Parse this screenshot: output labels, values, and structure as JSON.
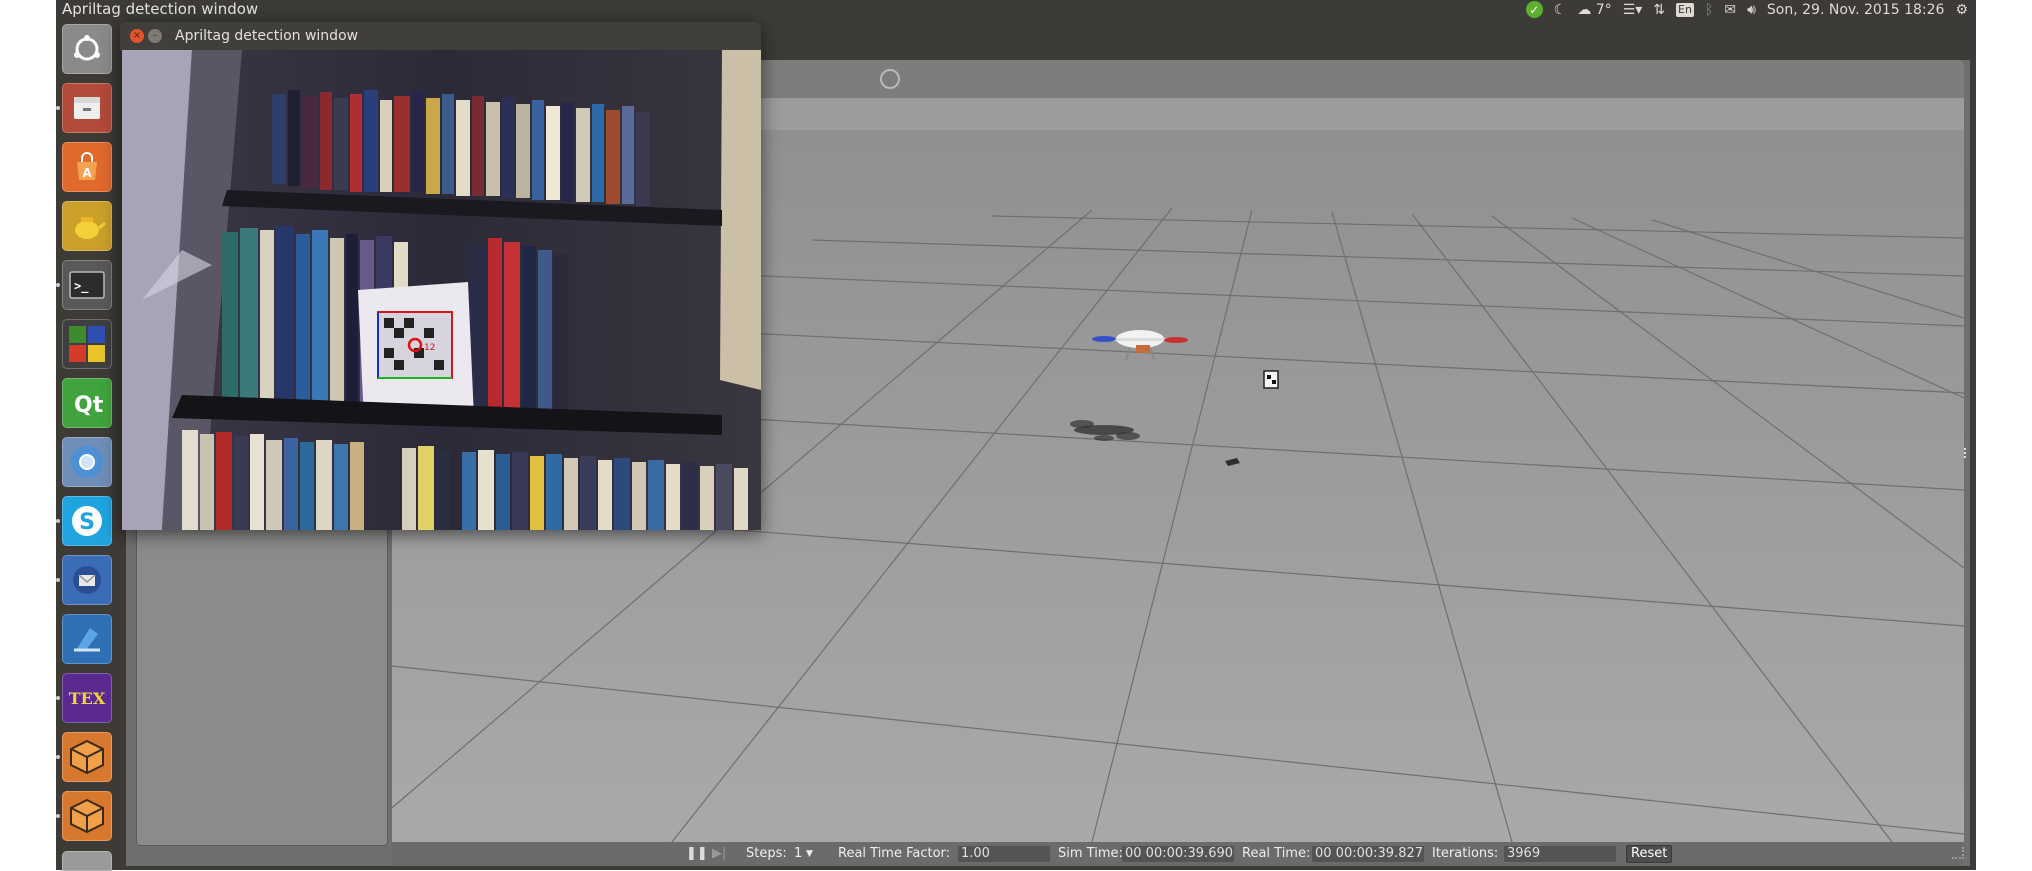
{
  "top_panel": {
    "app_title": "Apriltag detection window",
    "weather": "7°",
    "keyboard_layout": "En",
    "clock": "Son, 29. Nov. 2015 18:26"
  },
  "launcher": {
    "items": [
      {
        "name": "dash-home",
        "icon": "ubuntu-logo-icon",
        "color": "#8a8a8a"
      },
      {
        "name": "files",
        "icon": "file-cabinet-icon",
        "color": "#b34a3a"
      },
      {
        "name": "software-center",
        "icon": "shopping-bag-icon",
        "color": "#e0692c"
      },
      {
        "name": "ros-turtle",
        "icon": "teapot-icon",
        "color": "#d6a72a"
      },
      {
        "name": "terminal",
        "icon": "terminal-icon",
        "color": "#3b3b3b"
      },
      {
        "name": "workspaces",
        "icon": "workspace-grid-icon",
        "color": "#4a8a3a"
      },
      {
        "name": "qt-creator",
        "icon": "qt-logo-icon",
        "color": "#41a33d"
      },
      {
        "name": "chromium",
        "icon": "chromium-icon",
        "color": "#4d90d6"
      },
      {
        "name": "skype",
        "icon": "skype-icon",
        "color": "#1fa4e0"
      },
      {
        "name": "thunderbird",
        "icon": "thunderbird-icon",
        "color": "#3a6db5"
      },
      {
        "name": "downloader",
        "icon": "download-arrow-icon",
        "color": "#2f6fb3"
      },
      {
        "name": "texmaker",
        "icon": "tex-icon",
        "color": "#5b2a91"
      },
      {
        "name": "package-1",
        "icon": "package-box-icon",
        "color": "#d8782f"
      },
      {
        "name": "package-2",
        "icon": "package-box-icon",
        "color": "#d8782f"
      }
    ],
    "tex_label": "TEX"
  },
  "apriltag_window": {
    "title": "Apriltag detection window",
    "close_glyph": "×",
    "minimize_glyph": "–",
    "tag_id_label": "12"
  },
  "gazebo": {
    "bottom_bar": {
      "steps_label": "Steps:",
      "steps_value": "1",
      "real_time_factor_label": "Real Time Factor:",
      "real_time_factor_value": "1.00",
      "sim_time_label": "Sim Time:",
      "sim_time_value": "00 00:00:39.690",
      "real_time_label": "Real Time:",
      "real_time_value": "00 00:00:39.827",
      "iterations_label": "Iterations:",
      "iterations_value": "3969",
      "reset_label": "Reset"
    }
  }
}
